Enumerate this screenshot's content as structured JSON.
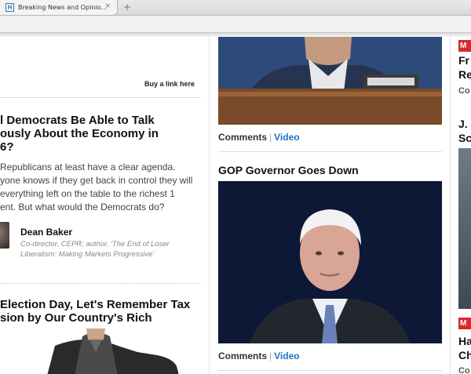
{
  "browser": {
    "tab_title": "Breaking News and Opinio...",
    "favicon_letter": "H",
    "tab_close": "×",
    "new_tab": "+"
  },
  "left": {
    "buy_link": "Buy a link here",
    "article1": {
      "headline_line1": "l Democrats Be Able to Talk",
      "headline_line2": "ously About the Economy in",
      "headline_line3": "6?",
      "snippet_line1": "Republicans at least have a clear agenda.",
      "snippet_line2": "yone knows if they get back in control they will",
      "snippet_line3": "everything left on the table to the richest 1",
      "snippet_line4": "ent. But what would the Democrats do?",
      "author_name": "Dean Baker",
      "author_bio_line1": "Co-director, CEPR; author, 'The End of Loser",
      "author_bio_line2": "Liberalism: Making Markets Progressive'"
    },
    "article2": {
      "headline_line1": "Election Day, Let's Remember Tax",
      "headline_line2": "sion by Our Country's Rich"
    }
  },
  "middle": {
    "item1": {
      "comments_label": "Comments",
      "separator": "|",
      "video_label": "Video"
    },
    "item2": {
      "headline": "GOP Governor Goes Down",
      "comments_label": "Comments",
      "separator": "|",
      "video_label": "Video"
    }
  },
  "right": {
    "badge1": "M",
    "item1_line1": "Fr",
    "item1_line2": "Re",
    "item1_byline": "Co",
    "item2_line1": "J.",
    "item2_line2": "Sc",
    "badge2": "M",
    "item3_line1": "Ha",
    "item3_line2": "Ch",
    "item3_byline": "Co"
  },
  "colors": {
    "badge_red": "#d82a2a",
    "video_link_blue": "#1a75c4"
  }
}
